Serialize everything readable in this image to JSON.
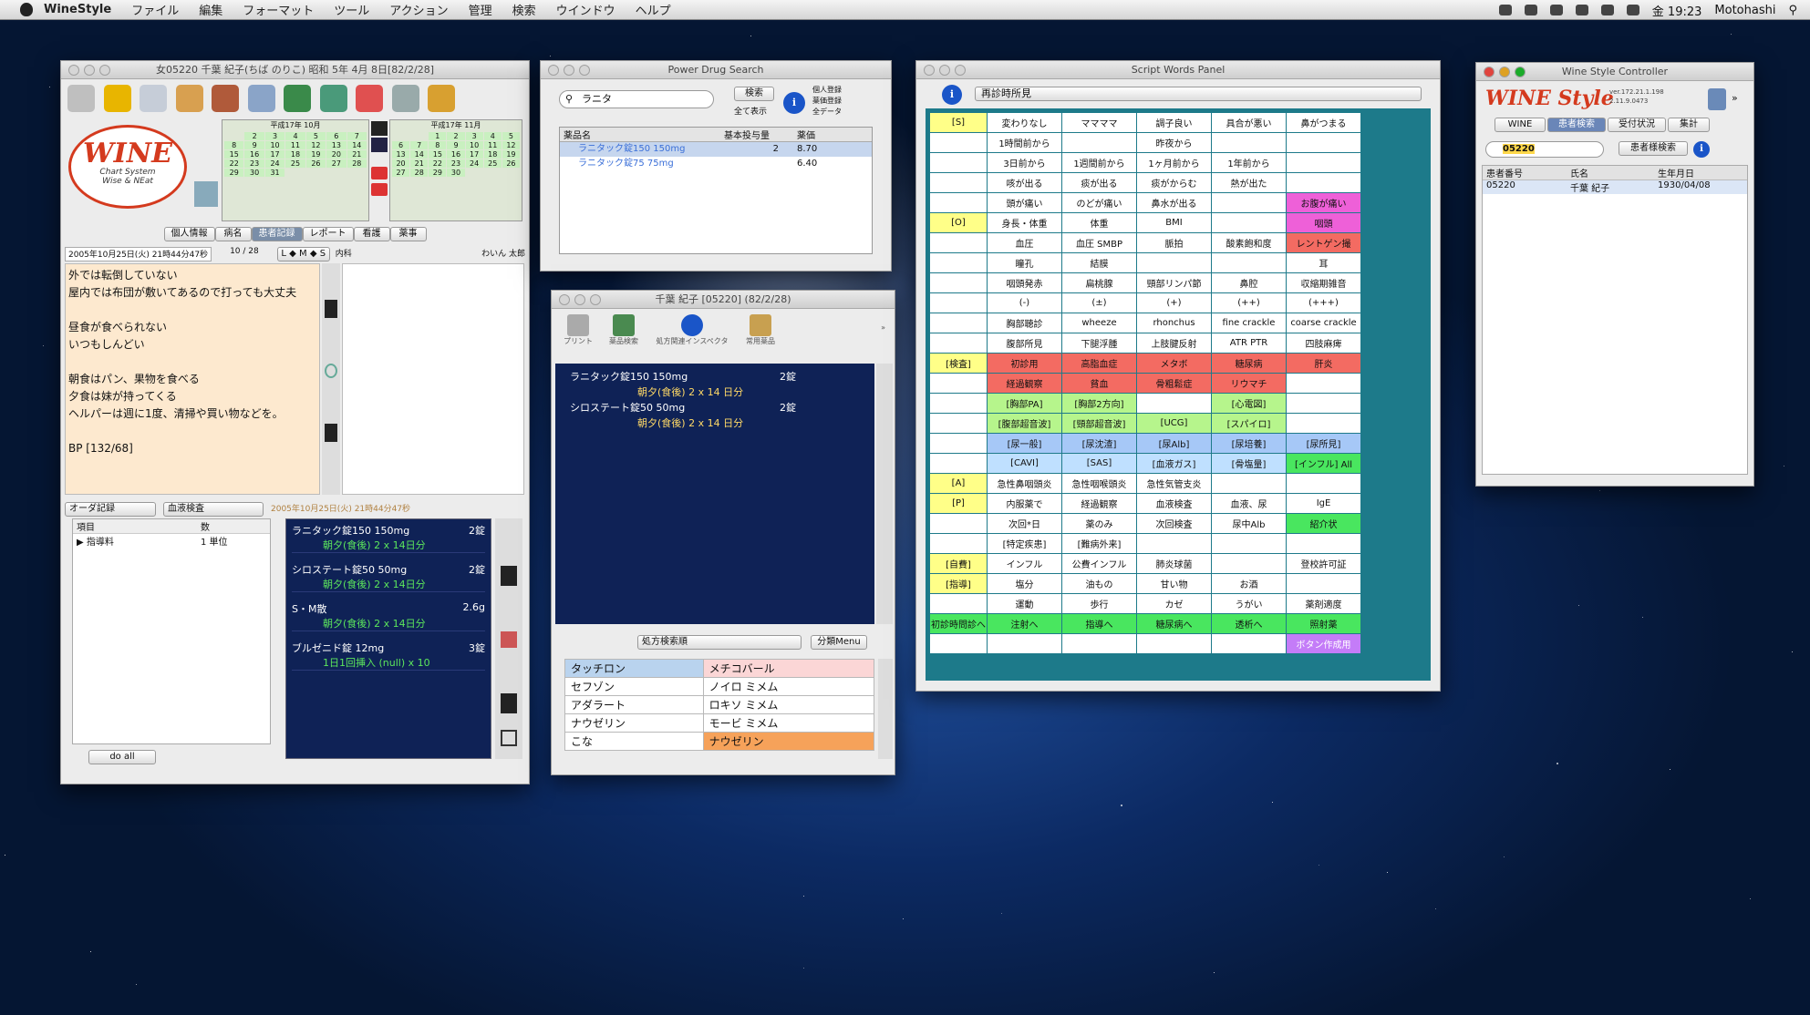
{
  "menubar": {
    "app": "WineStyle",
    "items": [
      "ファイル",
      "編集",
      "フォーマット",
      "ツール",
      "アクション",
      "管理",
      "検索",
      "ウインドウ",
      "ヘルプ"
    ],
    "clock": "金 19:23",
    "user": "Motohashi"
  },
  "chart_window": {
    "title": "女05220 千葉 紀子(ちば のりこ) 昭和 5年 4月 8日[82/2/28]",
    "logo_text": "WINE",
    "logo_sub": "Chart System\nWise & NEat",
    "cal1_title": "平成17年 10月",
    "cal2_title": "平成17年 11月",
    "cal1_days": [
      "2",
      "3",
      "4",
      "5",
      "6",
      "7",
      "8",
      "9",
      "10",
      "11",
      "12",
      "13",
      "14",
      "15",
      "16",
      "17",
      "18",
      "19",
      "20",
      "21",
      "22",
      "23",
      "24",
      "25",
      "26",
      "27",
      "28",
      "29",
      "30",
      "31"
    ],
    "cal2_days": [
      "1",
      "2",
      "3",
      "4",
      "5",
      "6",
      "7",
      "8",
      "9",
      "10",
      "11",
      "12",
      "13",
      "14",
      "15",
      "16",
      "17",
      "18",
      "19",
      "20",
      "21",
      "22",
      "23",
      "24",
      "25",
      "26",
      "27",
      "28",
      "29",
      "30"
    ],
    "tabs": [
      "個人情報",
      "病名",
      "患者記録",
      "レポート",
      "看護",
      "薬事"
    ],
    "date_line": "2005年10月25日(火) 21時44分47秒",
    "count": "10 / 28",
    "lms": "L ◆ M ◆ S",
    "dept": "内科",
    "doctor": "わいん 太郎",
    "notes": [
      "外では転倒していない",
      "屋内では布団が敷いてあるので打っても大丈夫",
      "",
      "昼食が食べられない",
      "いつもしんどい",
      "",
      "朝食はパン、果物を食べる",
      "夕食は妹が持ってくる",
      "ヘルパーは週に1度、清掃や買い物などを。",
      "",
      "BP [132/68]"
    ],
    "order_select": "オーダ記録",
    "exam_select": "血液検査",
    "order_date": "2005年10月25日(火) 21時44分47秒",
    "order_cols": [
      "項目",
      "数"
    ],
    "order_row": [
      "▶ 指導料",
      "1 単位"
    ],
    "do_all": "do all",
    "rx": [
      {
        "name": "ラニタック錠150 150mg",
        "qty": "2錠",
        "sub": "朝夕(食後) 2 x 14日分"
      },
      {
        "name": "シロステート錠50 50mg",
        "qty": "2錠",
        "sub": "朝夕(食後) 2 x 14日分"
      },
      {
        "name": "S・M散",
        "qty": "2.6g",
        "sub": "朝夕(食後) 2 x 14日分"
      },
      {
        "name": "ブルゼニド錠 12mg",
        "qty": "3錠",
        "sub": "1日1回挿入 (null) x 10"
      }
    ]
  },
  "drug_search": {
    "title": "Power Drug Search",
    "query": "ラニタ",
    "btn_search": "検索",
    "chk_all": "全て表示",
    "radios": [
      "個人登録",
      "薬価登録",
      "全データ"
    ],
    "cols": [
      "薬品名",
      "基本投与量",
      "薬価"
    ],
    "rows": [
      {
        "name": "ラニタック錠150 150mg",
        "dose": "2",
        "price": "8.70"
      },
      {
        "name": "ラニタック錠75 75mg",
        "dose": "",
        "price": "6.40"
      }
    ]
  },
  "rx_window": {
    "title": "千葉 紀子 [05220] (82/2/28)",
    "tools": [
      "プリント",
      "薬品検索",
      "処方関連インスペクタ",
      "常用薬品"
    ],
    "lines": [
      {
        "name": "ラニタック錠150 150mg",
        "qty": "2錠",
        "sub": "朝夕(食後)  2 x 14 日分"
      },
      {
        "name": "シロステート錠50 50mg",
        "qty": "2錠",
        "sub": "朝夕(食後)  2 x 14 日分"
      }
    ],
    "select": "処方検索順",
    "menu_btn": "分類Menu",
    "drug_grid": [
      [
        "タッチロン",
        "メチコバール"
      ],
      [
        "セフゾン",
        "ノイロ ミメム"
      ],
      [
        "アダラート",
        "ロキソ ミメム"
      ],
      [
        "ナウゼリン",
        "モービ ミメム"
      ],
      [
        "こな",
        "ナウゼリン"
      ]
    ]
  },
  "script_panel": {
    "title": "Script Words Panel",
    "select": "再診時所見",
    "grid": [
      [
        "[S]",
        "変わりなし",
        "ママママ",
        "調子良い",
        "具合が悪い",
        "鼻がつまる"
      ],
      [
        "",
        "1時間前から",
        "",
        "昨夜から",
        "",
        ""
      ],
      [
        "",
        "3日前から",
        "1週間前から",
        "1ヶ月前から",
        "1年前から",
        ""
      ],
      [
        "",
        "咳が出る",
        "痰が出る",
        "痰がからむ",
        "熱が出た",
        ""
      ],
      [
        "",
        "頭が痛い",
        "のどが痛い",
        "鼻水が出る",
        "",
        "お腹が痛い"
      ],
      [
        "[O]",
        "身長・体重",
        "体重",
        "BMI",
        "",
        "咽頭"
      ],
      [
        "",
        "血圧",
        "血圧 SMBP",
        "脈拍",
        "酸素飽和度",
        "レントゲン撮"
      ],
      [
        "",
        "瞳孔",
        "結膜",
        "",
        "",
        "耳"
      ],
      [
        "",
        "咽頭発赤",
        "扁桃腺",
        "頸部リンパ節",
        "鼻腔",
        "収縮期雑音"
      ],
      [
        "",
        "(-)",
        "(±)",
        "(+)",
        "(++)",
        "(+++)"
      ],
      [
        "",
        "胸部聴診",
        "wheeze",
        "rhonchus",
        "fine crackle",
        "coarse crackle"
      ],
      [
        "",
        "腹部所見",
        "下腿浮腫",
        "上肢腱反射",
        "ATR PTR",
        "四肢麻痺"
      ],
      [
        "[検査]",
        "初診用",
        "高脂血症",
        "メタボ",
        "糖尿病",
        "肝炎"
      ],
      [
        "",
        "経過観察",
        "貧血",
        "骨粗鬆症",
        "リウマチ",
        ""
      ],
      [
        "",
        "[胸部PA]",
        "[胸部2方向]",
        "",
        "[心電図]",
        ""
      ],
      [
        "",
        "[腹部超音波]",
        "[頸部超音波]",
        "[UCG]",
        "[スパイロ]",
        ""
      ],
      [
        "",
        "[尿一般]",
        "[尿沈渣]",
        "[尿Alb]",
        "[尿培養]",
        "[尿所見]"
      ],
      [
        "",
        "[CAVI]",
        "[SAS]",
        "[血液ガス]",
        "[骨塩量]",
        "[インフル] All"
      ],
      [
        "[A]",
        "急性鼻咽頭炎",
        "急性咽喉頭炎",
        "急性気管支炎",
        "",
        ""
      ],
      [
        "[P]",
        "内服薬で",
        "経過観察",
        "血液検査",
        "血液、尿",
        "IgE"
      ],
      [
        "",
        "次回*日",
        "薬のみ",
        "次回検査",
        "尿中Alb",
        "紹介状"
      ],
      [
        "",
        "[特定疾患]",
        "[難病外来]",
        "",
        "",
        ""
      ],
      [
        "[自費]",
        "インフル",
        "公費インフル",
        "肺炎球菌",
        "",
        "登校許可証"
      ],
      [
        "[指導]",
        "塩分",
        "油もの",
        "甘い物",
        "お酒",
        ""
      ],
      [
        "",
        "運動",
        "歩行",
        "カゼ",
        "うがい",
        "薬剤適度"
      ],
      [
        "初診時問診へ",
        "注射へ",
        "指導へ",
        "糖尿病へ",
        "透析へ",
        "照射薬"
      ],
      [
        "",
        "",
        "",
        "",
        "",
        "ボタン作成用"
      ]
    ],
    "colors": [
      [
        "c-y",
        "",
        "",
        "",
        "",
        ""
      ],
      [
        "",
        "",
        "",
        "",
        "",
        ""
      ],
      [
        "",
        "",
        "",
        "",
        "",
        ""
      ],
      [
        "",
        "",
        "",
        "",
        "",
        ""
      ],
      [
        "",
        "",
        "",
        "",
        "",
        "c-m"
      ],
      [
        "c-y",
        "",
        "",
        "",
        "",
        "c-m"
      ],
      [
        "",
        "",
        "",
        "",
        "",
        "c-r"
      ],
      [
        "",
        "",
        "",
        "",
        "",
        ""
      ],
      [
        "",
        "",
        "",
        "",
        "",
        ""
      ],
      [
        "",
        "",
        "",
        "",
        "",
        ""
      ],
      [
        "",
        "",
        "",
        "",
        "",
        ""
      ],
      [
        "",
        "",
        "",
        "",
        "",
        ""
      ],
      [
        "c-y",
        "c-r",
        "c-r",
        "c-r",
        "c-r",
        "c-r"
      ],
      [
        "",
        "c-r",
        "c-r",
        "c-r",
        "c-r",
        ""
      ],
      [
        "",
        "c-g",
        "c-g",
        "",
        "c-g",
        ""
      ],
      [
        "",
        "c-g",
        "c-g",
        "c-g",
        "c-g",
        ""
      ],
      [
        "",
        "c-b",
        "c-b",
        "c-b",
        "c-b",
        "c-b"
      ],
      [
        "",
        "c-lb",
        "c-lb",
        "c-lb",
        "c-lb",
        "c-gr"
      ],
      [
        "c-y",
        "",
        "",
        "",
        "",
        ""
      ],
      [
        "c-y",
        "",
        "",
        "",
        "",
        ""
      ],
      [
        "",
        "",
        "",
        "",
        "",
        "c-gr"
      ],
      [
        "",
        "",
        "",
        "",
        "",
        ""
      ],
      [
        "c-y",
        "",
        "",
        "",
        "",
        ""
      ],
      [
        "c-y",
        "",
        "",
        "",
        "",
        ""
      ],
      [
        "",
        "",
        "",
        "",
        "",
        ""
      ],
      [
        "c-gr",
        "c-gr",
        "c-gr",
        "c-gr",
        "c-gr",
        "c-gr"
      ],
      [
        "",
        "",
        "",
        "",
        "",
        "c-p"
      ]
    ]
  },
  "controller": {
    "title": "Wine Style Controller",
    "brand": "WINE Style",
    "ip": "ver.172.21.1.198",
    "ver": "2.11.9.0473",
    "tabs": [
      "WINE",
      "患者検索",
      "受付状況",
      "集計"
    ],
    "query": "05220",
    "search_btn": "患者様検索",
    "cols": [
      "患者番号",
      "氏名",
      "生年月日"
    ],
    "row": [
      "05220",
      "千葉 紀子",
      "1930/04/08"
    ]
  },
  "colors": {
    "accent": "#3a6fd8",
    "rx_bg": "#0f2256",
    "logo_red": "#d43a1e"
  }
}
